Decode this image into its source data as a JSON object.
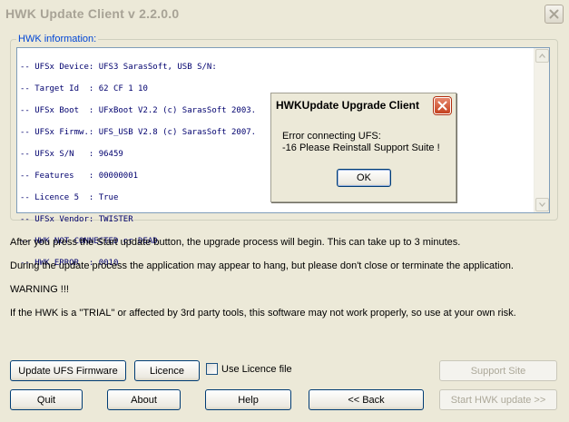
{
  "window": {
    "title": "HWK Update Client  v 2.2.0.0"
  },
  "info": {
    "group_label": "HWK information:",
    "lines": [
      "-- UFSx Device: UFS3 SarasSoft, USB S/N:",
      "-- Target Id  : 62 CF 1 10",
      "-- UFSx Boot  : UFxBoot V2.2 (c) SarasSoft 2003.",
      "-- UFSx Firmw.: UFS_USB V2.8 (c) SarasSoft 2007.",
      "-- UFSx S/N   : 96459",
      "-- Features   : 00000001",
      "-- Licence 5  : True",
      "-- UFSx Vendor: TWISTER",
      "-- HWK NOT CONNECTED or DEAD",
      "-- HWK ERROR  : 0010"
    ]
  },
  "messages": {
    "line1": "After you press the Start update button, the upgrade process will begin.  This can take up to 3 minutes.",
    "line2": "During the update process the application may appear to hang, but please don't close or terminate the application.",
    "line3": "WARNING !!!",
    "line4": "If the HWK is a \"TRIAL\" or affected by 3rd party tools, this software may not work properly, so use at your own risk."
  },
  "buttons": {
    "update_ufs_firmware": "Update UFS Firmware",
    "licence": "Licence",
    "use_licence_file": "Use Licence file",
    "support_site": "Support Site",
    "quit": "Quit",
    "about": "About",
    "help": "Help",
    "back": "<< Back",
    "start_update": "Start HWK update >>"
  },
  "dialog": {
    "title": "HWKUpdate Upgrade Client",
    "message_line1": "Error connecting UFS:",
    "message_line2": "-16 Please Reinstall Support Suite !",
    "ok_label": "OK"
  },
  "colors": {
    "window_bg": "#ece9d8",
    "group_label": "#0046d5",
    "info_text": "#00006e",
    "button_border": "#003c74",
    "dialog_close": "#c4411f"
  }
}
